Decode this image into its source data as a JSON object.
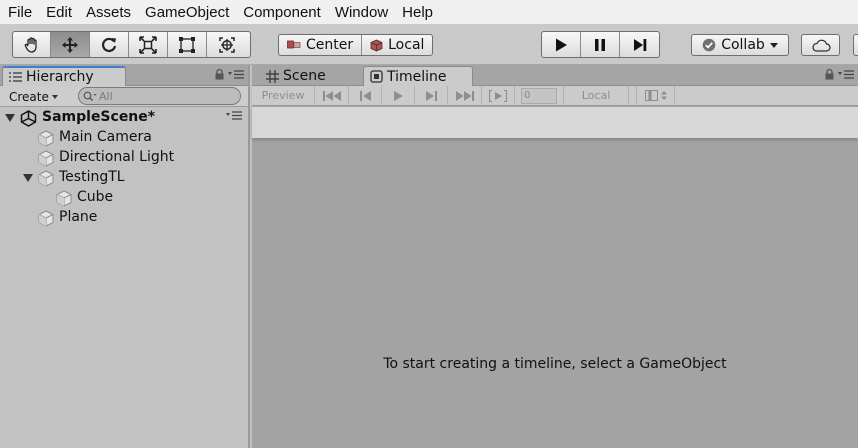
{
  "menu": {
    "items": [
      "File",
      "Edit",
      "Assets",
      "GameObject",
      "Component",
      "Window",
      "Help"
    ]
  },
  "toolbar": {
    "tools": [
      "hand-tool",
      "move-tool",
      "rotate-tool",
      "scale-tool",
      "rect-tool",
      "transform-tool"
    ],
    "active_tool": "move-tool",
    "pivot_label": "Center",
    "space_label": "Local",
    "collab_label": "Collab"
  },
  "hierarchy": {
    "tab_label": "Hierarchy",
    "create_label": "Create",
    "search_placeholder": "All",
    "scene_name": "SampleScene*",
    "items": [
      {
        "label": "Main Camera"
      },
      {
        "label": "Directional Light"
      },
      {
        "label": "TestingTL"
      },
      {
        "label": "Cube"
      },
      {
        "label": "Plane"
      }
    ]
  },
  "timeline": {
    "scene_tab_label": "Scene",
    "timeline_tab_label": "Timeline",
    "preview_label": "Preview",
    "frame_value": "0",
    "local_label": "Local",
    "empty_message": "To start creating a timeline, select a GameObject"
  },
  "colors": {
    "active_tab_accent": "#3f7fd1",
    "panel_bg": "#c2c2c2",
    "timeline_bg": "#a3a3a3"
  }
}
